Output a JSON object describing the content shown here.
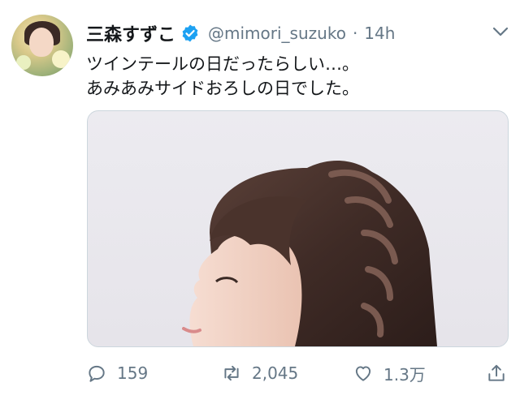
{
  "tweet": {
    "author_name": "三森すずこ",
    "handle": "@mimori_suzuko",
    "separator": "·",
    "time": "14h",
    "text_lines": [
      "ツインテールの日だったらしい…。",
      "あみあみサイドおろしの日でした。"
    ]
  },
  "actions": {
    "reply_count": "159",
    "retweet_count": "2,045",
    "like_count": "1.3万"
  },
  "icons": {
    "verified": "verified-badge-icon",
    "menu": "chevron-down-icon",
    "reply": "reply-icon",
    "retweet": "retweet-icon",
    "like": "heart-icon",
    "share": "share-icon"
  },
  "colors": {
    "verified_blue": "#1da1f2",
    "secondary_text": "#657786",
    "primary_text": "#14171a",
    "border": "#ccd6dd"
  }
}
